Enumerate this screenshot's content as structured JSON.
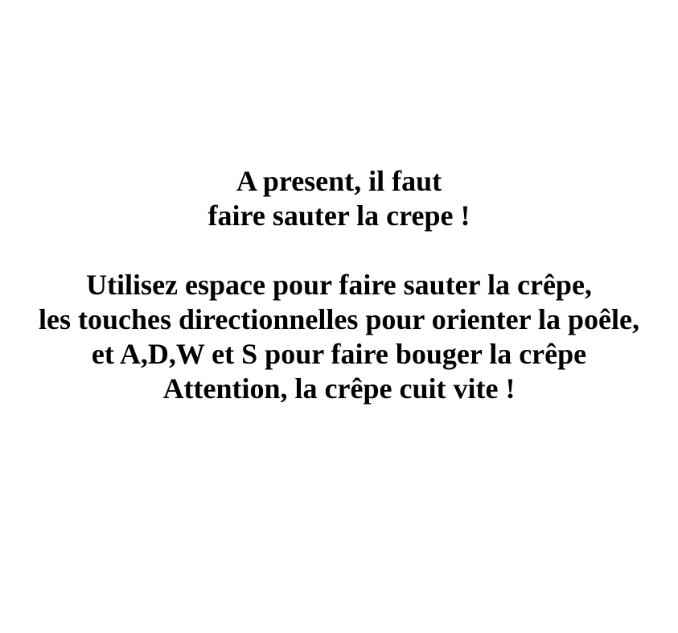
{
  "colors": {
    "background": "#ffffff",
    "text": "#000000"
  },
  "intro": {
    "line1": "A present, il faut",
    "line2": "faire sauter la crepe !"
  },
  "instructions": {
    "line1": "Utilisez espace pour faire sauter la crêpe,",
    "line2": "les touches directionnelles pour orienter la poêle,",
    "line3": "et A,D,W et S pour faire bouger la crêpe",
    "line4": "Attention, la crêpe cuit vite !"
  }
}
